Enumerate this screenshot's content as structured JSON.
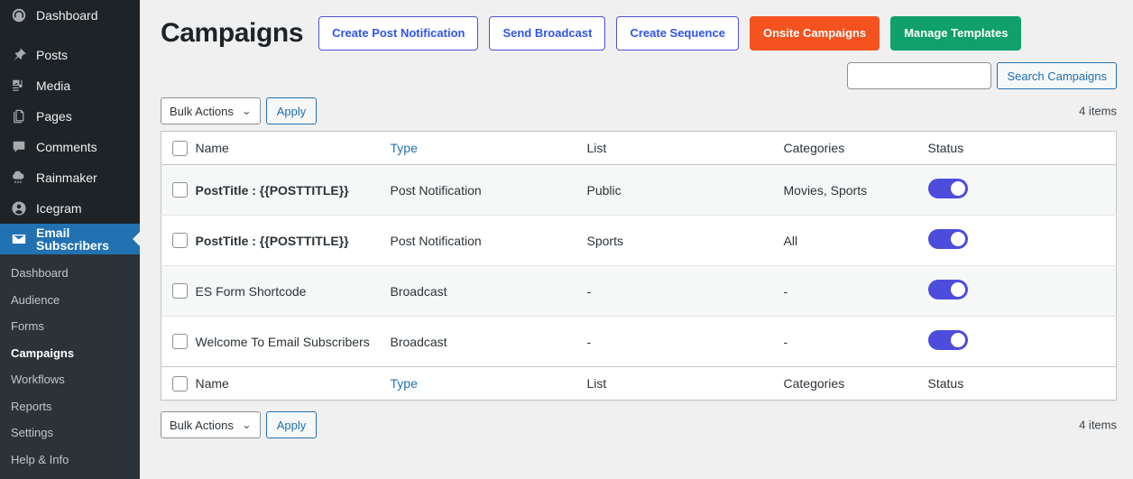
{
  "sidebar": {
    "items": [
      {
        "label": "Dashboard",
        "icon": "dashboard-icon",
        "active": false
      },
      {
        "label": "Posts",
        "icon": "pin-icon",
        "active": false
      },
      {
        "label": "Media",
        "icon": "media-icon",
        "active": false
      },
      {
        "label": "Pages",
        "icon": "pages-icon",
        "active": false
      },
      {
        "label": "Comments",
        "icon": "comment-icon",
        "active": false
      },
      {
        "label": "Rainmaker",
        "icon": "cloud-rain-icon",
        "active": false
      },
      {
        "label": "Icegram",
        "icon": "user-circle-icon",
        "active": false
      },
      {
        "label": "Email Subscribers",
        "icon": "envelope-icon",
        "active": true
      }
    ],
    "submenu": [
      {
        "label": "Dashboard",
        "current": false
      },
      {
        "label": "Audience",
        "current": false
      },
      {
        "label": "Forms",
        "current": false
      },
      {
        "label": "Campaigns",
        "current": true
      },
      {
        "label": "Workflows",
        "current": false
      },
      {
        "label": "Reports",
        "current": false
      },
      {
        "label": "Settings",
        "current": false
      },
      {
        "label": "Help & Info",
        "current": false
      }
    ]
  },
  "header": {
    "title": "Campaigns",
    "buttons": [
      {
        "label": "Create Post Notification",
        "style": "outline"
      },
      {
        "label": "Send Broadcast",
        "style": "outline"
      },
      {
        "label": "Create Sequence",
        "style": "outline"
      },
      {
        "label": "Onsite Campaigns",
        "style": "orange"
      },
      {
        "label": "Manage Templates",
        "style": "green"
      }
    ]
  },
  "search": {
    "value": "",
    "placeholder": "",
    "submit_label": "Search Campaigns"
  },
  "tablenav_top": {
    "bulk_label": "Bulk Actions",
    "chevron": "⌄",
    "apply_label": "Apply",
    "items_count": "4 items"
  },
  "tablenav_bottom": {
    "bulk_label": "Bulk Actions",
    "chevron": "⌄",
    "apply_label": "Apply",
    "items_count": "4 items"
  },
  "table": {
    "columns": {
      "name": "Name",
      "type": "Type",
      "list": "List",
      "categories": "Categories",
      "status": "Status"
    },
    "rows": [
      {
        "name": "PostTitle : {{POSTTITLE}}",
        "bold": true,
        "type": "Post Notification",
        "list": "Public",
        "categories": "Movies, Sports",
        "status_on": true
      },
      {
        "name": "PostTitle : {{POSTTITLE}}",
        "bold": true,
        "type": "Post Notification",
        "list": "Sports",
        "categories": "All",
        "status_on": true
      },
      {
        "name": "ES Form Shortcode",
        "bold": false,
        "type": "Broadcast",
        "list": "-",
        "categories": "-",
        "status_on": true
      },
      {
        "name": "Welcome To Email Subscribers",
        "bold": false,
        "type": "Broadcast",
        "list": "-",
        "categories": "-",
        "status_on": true
      }
    ]
  },
  "colors": {
    "sidebar_bg": "#1d2327",
    "submenu_bg": "#2c3338",
    "active_blue": "#2271b1",
    "link_blue": "#2271b1",
    "outline_border": "#5050e0",
    "outline_text": "#2f54eb",
    "orange": "#f4521e",
    "green": "#10a06b",
    "toggle_on": "#4c4ddc",
    "page_bg": "#f0f0f1"
  }
}
